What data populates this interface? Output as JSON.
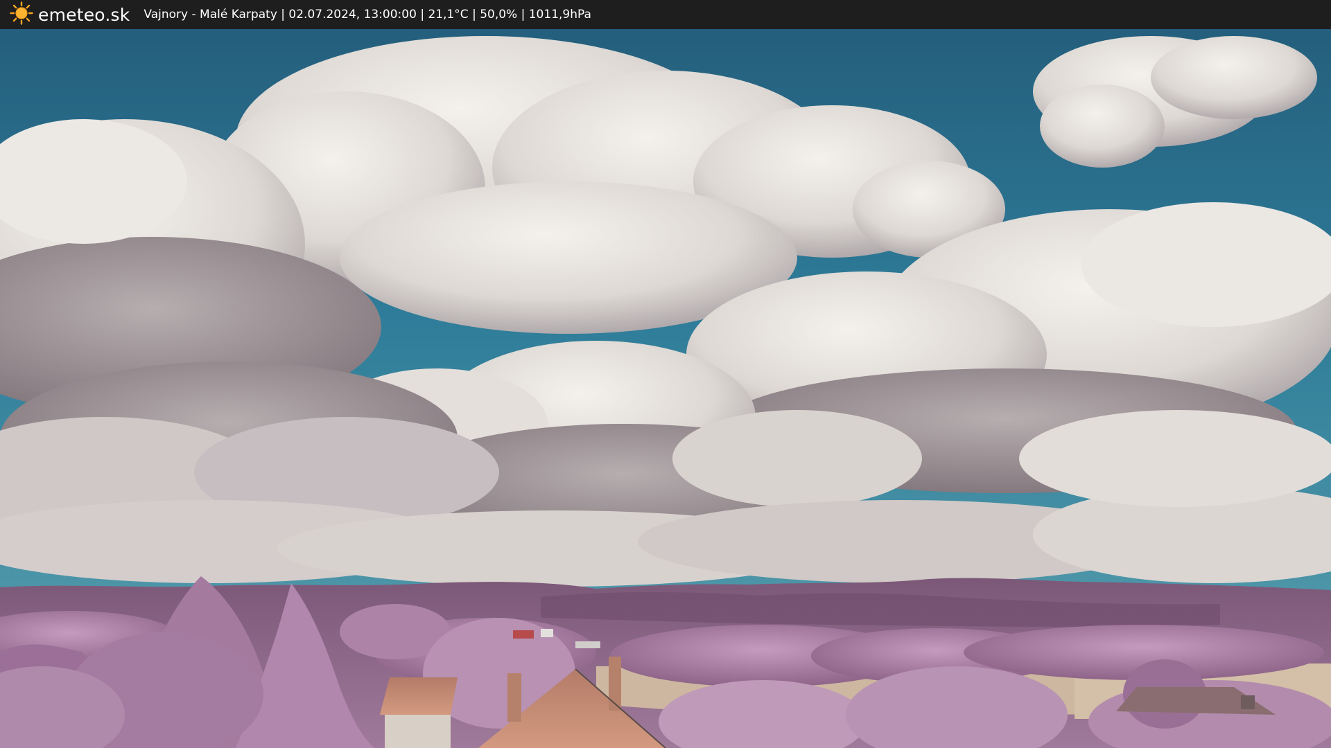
{
  "header": {
    "brand": "emeteo.sk",
    "caption": "Vajnory - Malé Karpaty | 02.07.2024, 13:00:00 | 21,1°C | 50,0% | 1011,9hPa",
    "logo_icon": "sun-icon"
  },
  "colors": {
    "bar": "#1e1e1e",
    "sky": "#2e7c99",
    "foliage": "#a07a9f",
    "hills": "#8c6585",
    "roof": "#c7876c",
    "field": "#cdb7a0",
    "sun": "#f5a623"
  }
}
